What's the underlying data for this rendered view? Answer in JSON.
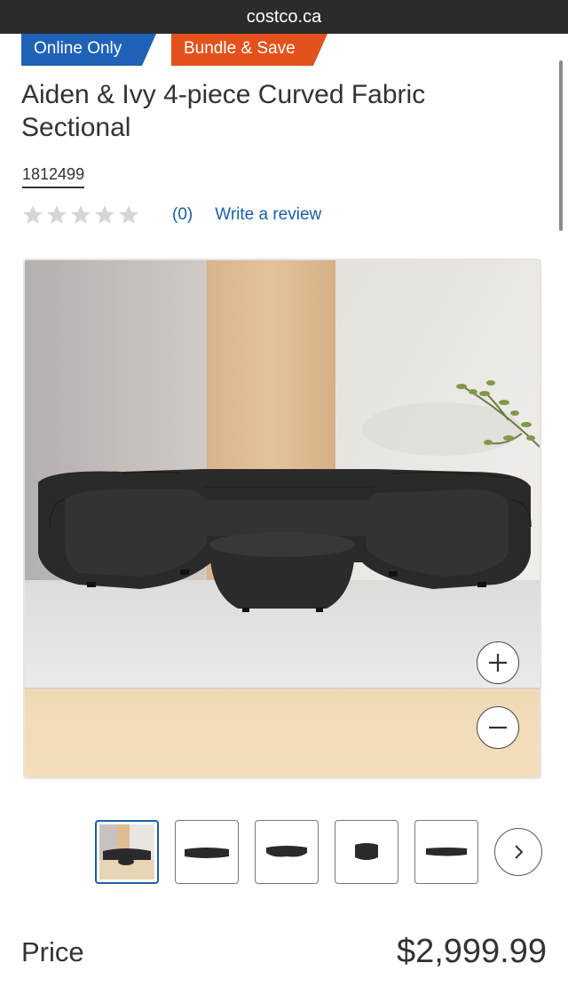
{
  "browser": {
    "url": "costco.ca"
  },
  "badges": {
    "online": "Online Only",
    "bundle": "Bundle & Save"
  },
  "product": {
    "title": "Aiden & Ivy 4-piece Curved Fabric Sectional",
    "item_number": "1812499",
    "rating": {
      "stars": 0,
      "max_stars": 5,
      "count": "(0)",
      "write_review": "Write a review"
    }
  },
  "gallery": {
    "main_image": "sofa-product-image",
    "thumbnail_count": 5,
    "selected_index": 0,
    "icons": {
      "zoom_in": "plus-icon",
      "zoom_out": "minus-icon",
      "next": "chevron-right-icon"
    }
  },
  "price": {
    "label": "Price",
    "value": "$2,999.99"
  },
  "colors": {
    "badge_blue": "#1f62b8",
    "badge_orange": "#e3521c",
    "link": "#1a5fa8",
    "sofa": "#2a2a2a"
  }
}
